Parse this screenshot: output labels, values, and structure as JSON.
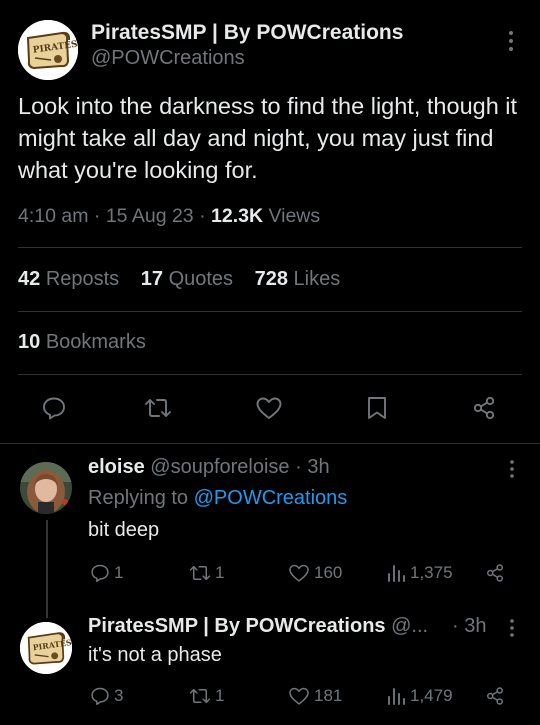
{
  "tweet": {
    "display_name": "PiratesSMP | By POWCreations",
    "handle": "@POWCreations",
    "body": "Look into the darkness to find the light, though it might take all day and night, you may just find what you're looking for.",
    "time": "4:10 am",
    "date": "15 Aug 23",
    "views_count": "12.3K",
    "views_label": "Views",
    "reposts_count": "42",
    "reposts_label": "Reposts",
    "quotes_count": "17",
    "quotes_label": "Quotes",
    "likes_count": "728",
    "likes_label": "Likes",
    "bookmarks_count": "10",
    "bookmarks_label": "Bookmarks",
    "avatar_logo_text": "PIRATES"
  },
  "replies": [
    {
      "display_name": "eloise",
      "handle": "@soupforeloise",
      "time": "· 3h",
      "replying_label": "Replying to",
      "replying_to": "@POWCreations",
      "text": "bit deep",
      "replies": "1",
      "reposts": "1",
      "likes": "160",
      "views": "1,375"
    },
    {
      "display_name": "PiratesSMP | By POWCreations",
      "handle": "@...",
      "time": "· 3h",
      "text": "it's not a phase",
      "replies": "3",
      "reposts": "1",
      "likes": "181",
      "views": "1,479"
    }
  ],
  "colors": {
    "background": "#000000",
    "text": "#e7e9ea",
    "muted": "#71767b",
    "accent": "#1d9bf0",
    "divider": "#2f3336"
  },
  "icons": [
    "more-icon",
    "reply-icon",
    "repost-icon",
    "like-icon",
    "bookmark-icon",
    "share-icon",
    "views-icon"
  ]
}
